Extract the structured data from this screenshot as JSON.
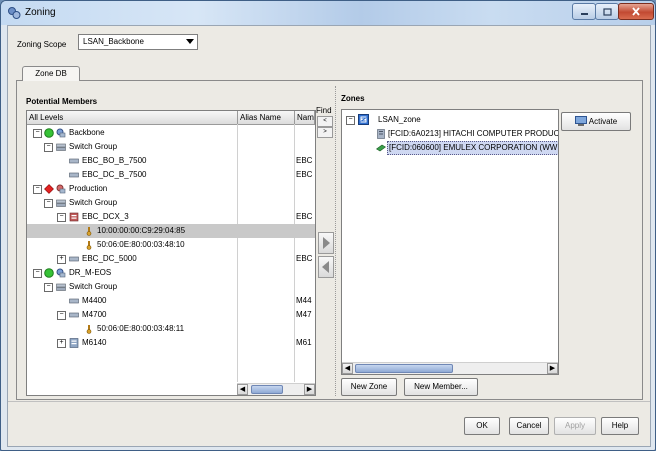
{
  "window": {
    "title": "Zoning"
  },
  "scope": {
    "label": "Zoning Scope",
    "value": "LSAN_Backbone"
  },
  "tabs": [
    {
      "label": "Zone DB"
    }
  ],
  "potential_members": {
    "label": "Potential Members",
    "columns": [
      "All Levels",
      "Alias Name",
      "Nam"
    ],
    "rows": [
      {
        "label": "Backbone",
        "name": ""
      },
      {
        "label": "Switch Group",
        "name": ""
      },
      {
        "label": "EBC_BO_B_7500",
        "name": "EBC"
      },
      {
        "label": "EBC_DC_B_7500",
        "name": "EBC"
      },
      {
        "label": "Production",
        "name": ""
      },
      {
        "label": "Switch Group",
        "name": ""
      },
      {
        "label": "EBC_DCX_3",
        "name": "EBC"
      },
      {
        "label": "10:00:00:00:C9:29:04:85",
        "name": ""
      },
      {
        "label": "50:06:0E:80:00:03:48:10",
        "name": ""
      },
      {
        "label": "EBC_DC_5000",
        "name": "EBC"
      },
      {
        "label": "DR_M-EOS",
        "name": ""
      },
      {
        "label": "Switch Group",
        "name": ""
      },
      {
        "label": "M4400",
        "name": "M44"
      },
      {
        "label": "M4700",
        "name": "M47"
      },
      {
        "label": "50:06:0E:80:00:03:48:11",
        "name": ""
      },
      {
        "label": "M6140",
        "name": "M61"
      }
    ]
  },
  "find": {
    "label": "Find",
    "up": "<",
    "down": ">"
  },
  "zones": {
    "label": "Zones",
    "rows": [
      {
        "label": "LSAN_zone"
      },
      {
        "label": "[FCID:6A0213] HITACHI COMPUTER PRODUC"
      },
      {
        "label": "[FCID:060600] EMULEX CORPORATION (WW"
      }
    ]
  },
  "buttons": {
    "activate": "Activate",
    "new_zone": "New Zone",
    "new_member": "New Member...",
    "ok": "OK",
    "cancel": "Cancel",
    "apply": "Apply",
    "help": "Help"
  },
  "icons": {
    "window_icon": "zoning-icon",
    "status_ok": "green-circle-icon",
    "status_error": "red-diamond-icon"
  },
  "colors": {
    "selection": "#c9c9c9",
    "zone_selection": "#cfd8f2",
    "title_bar": "#b9d3ee",
    "close_button": "#c24a32"
  }
}
